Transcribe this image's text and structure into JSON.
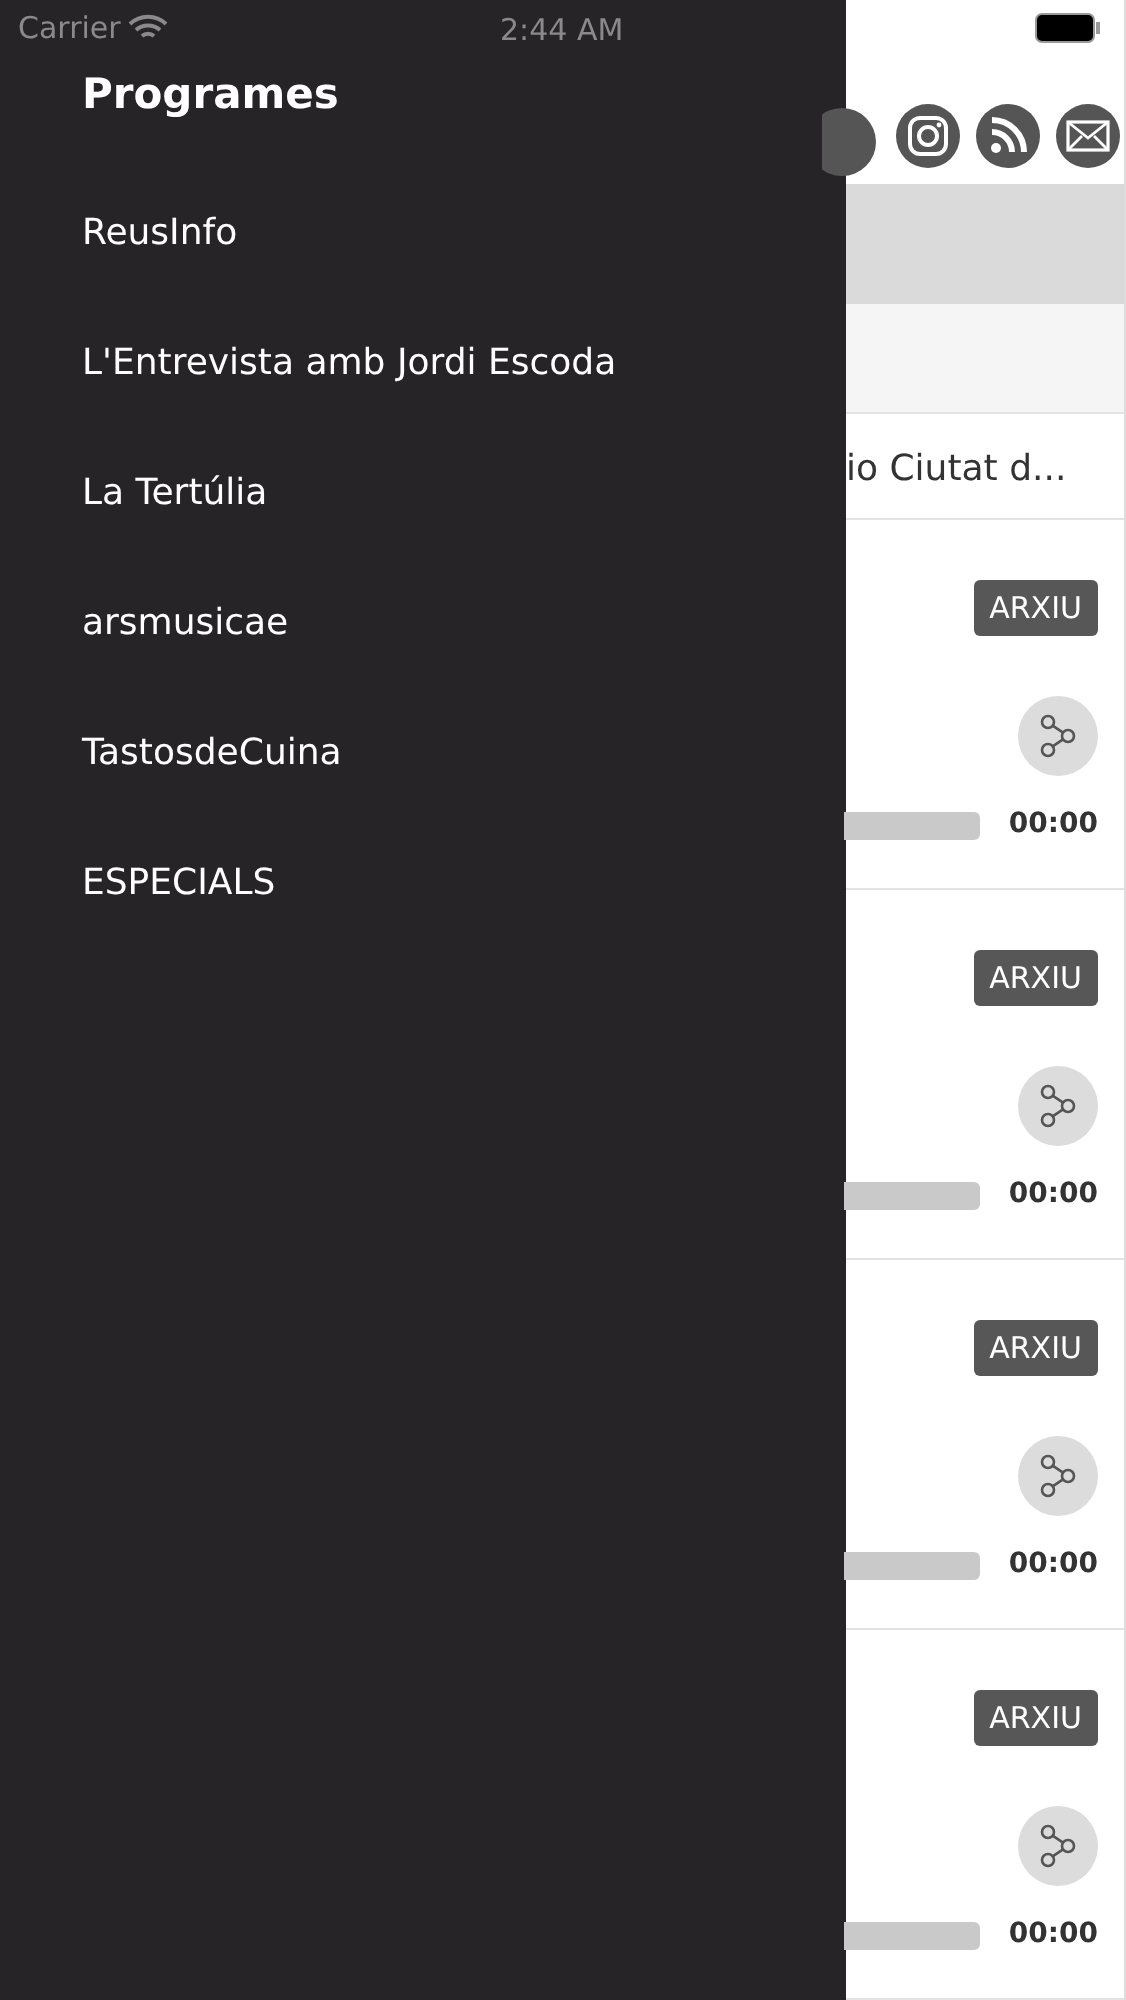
{
  "status_bar": {
    "carrier": "Carrier",
    "time": "2:44 AM"
  },
  "drawer": {
    "title": "Programes",
    "items": [
      {
        "label": "ReusInfo"
      },
      {
        "label": "L'Entrevista amb Jordi Escoda"
      },
      {
        "label": "La Tertúlia"
      },
      {
        "label": "arsmusicae"
      },
      {
        "label": "TastosdeCuina"
      },
      {
        "label": "ESPECIALS"
      }
    ]
  },
  "content": {
    "title": "io Ciutat d...",
    "episodes": [
      {
        "badge": "ARXIU",
        "time": "00:00"
      },
      {
        "badge": "ARXIU",
        "time": "00:00"
      },
      {
        "badge": "ARXIU",
        "time": "00:00"
      },
      {
        "badge": "ARXIU",
        "time": "00:00"
      }
    ]
  }
}
